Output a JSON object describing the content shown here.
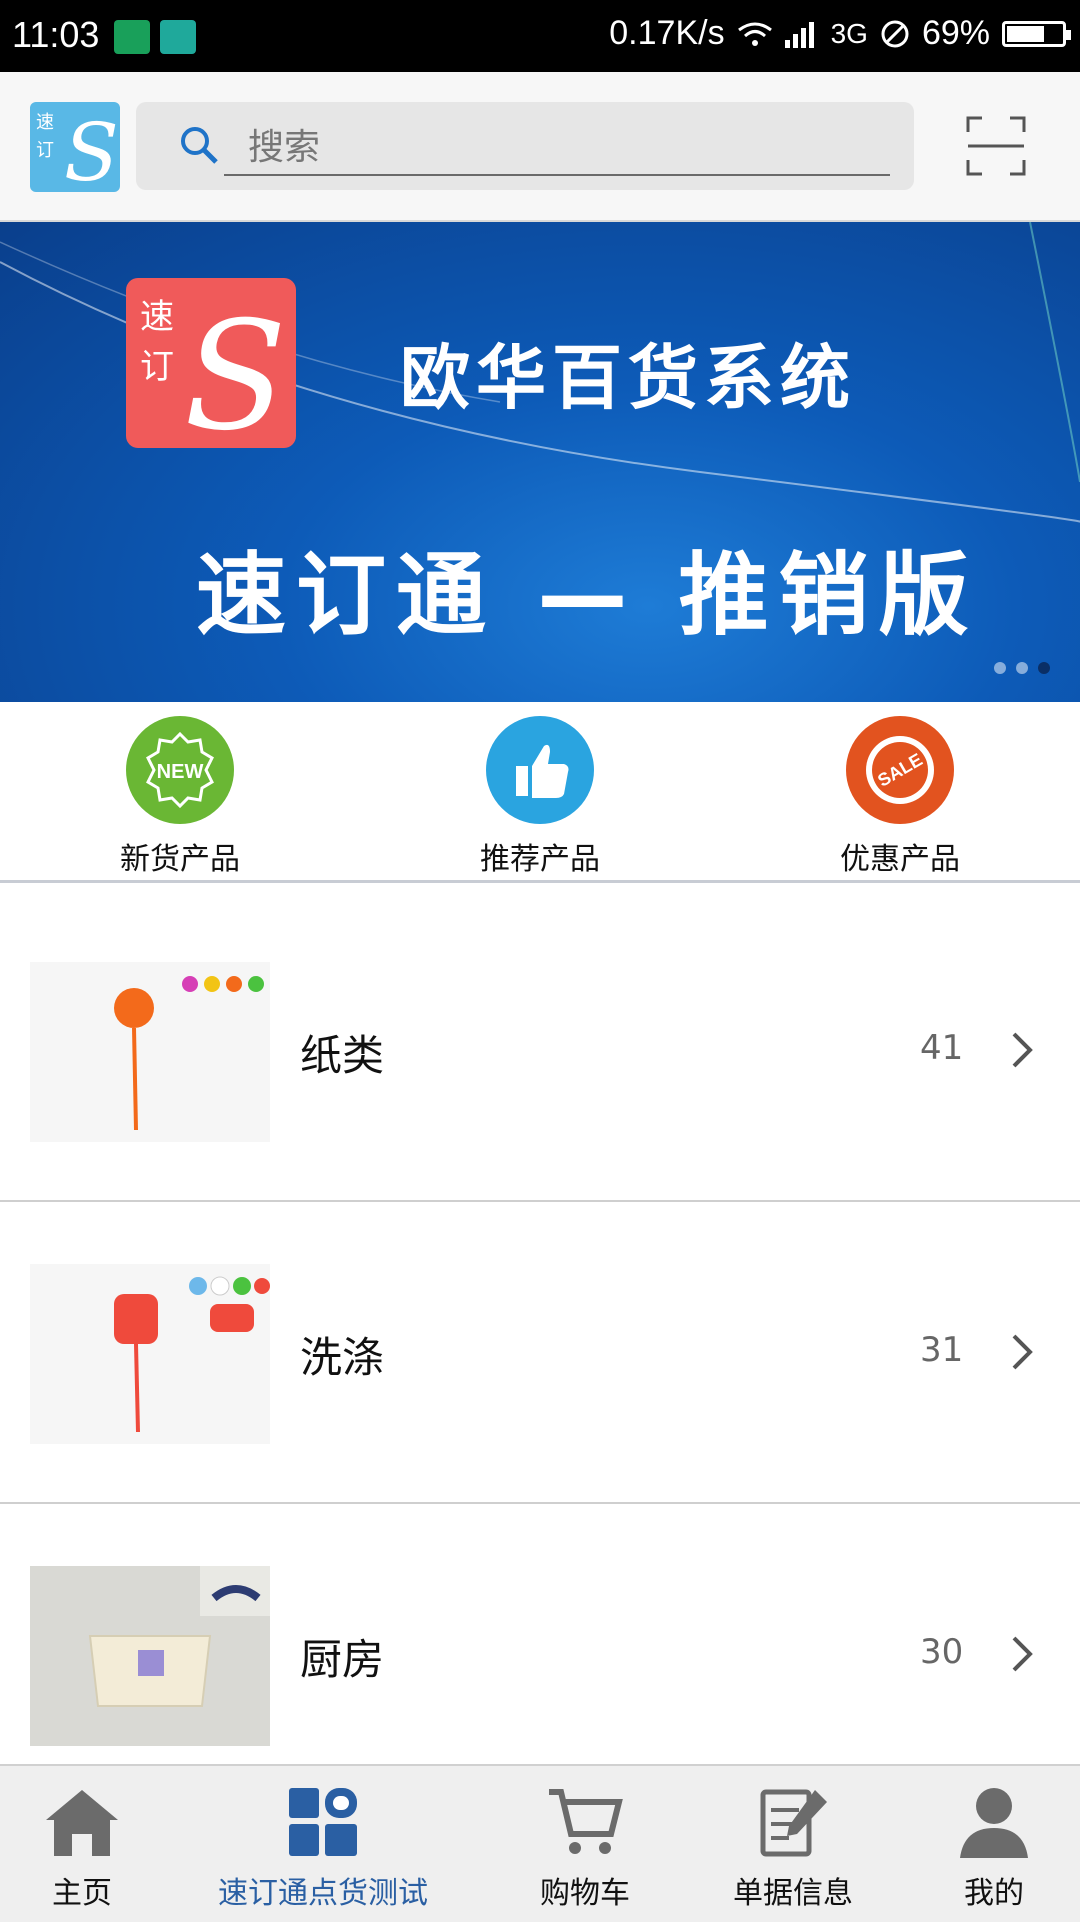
{
  "status_bar": {
    "time": "11:03",
    "speed": "0.17K/s",
    "network": "3G",
    "battery": "69%",
    "battery_level": 0.69
  },
  "search": {
    "placeholder": "搜索"
  },
  "banner": {
    "logo_text": "速订",
    "title": "欧华百货系统",
    "subtitle": "速订通 — 推销版",
    "active_dot": 3,
    "dot_count": 3
  },
  "quick_links": [
    {
      "label": "新货产品",
      "icon": "new-badge-icon",
      "color": "#6ab734"
    },
    {
      "label": "推荐产品",
      "icon": "thumbs-up-icon",
      "color": "#2aa4e0"
    },
    {
      "label": "优惠产品",
      "icon": "sale-tag-icon",
      "color": "#e2531f"
    }
  ],
  "categories": [
    {
      "name": "纸类",
      "count": "41"
    },
    {
      "name": "洗涤",
      "count": "31"
    },
    {
      "name": "厨房",
      "count": "30"
    }
  ],
  "tabs": [
    {
      "label": "主页",
      "icon": "home-icon"
    },
    {
      "label": "速订通点货测试",
      "icon": "grid-icon",
      "active": true
    },
    {
      "label": "购物车",
      "icon": "cart-icon"
    },
    {
      "label": "单据信息",
      "icon": "document-icon"
    },
    {
      "label": "我的",
      "icon": "user-icon"
    }
  ],
  "colors": {
    "accent": "#2a5fa3",
    "banner_bg": "#0d5bb8",
    "logo_red": "#f05a5a",
    "logo_blue": "#59b8e6"
  }
}
